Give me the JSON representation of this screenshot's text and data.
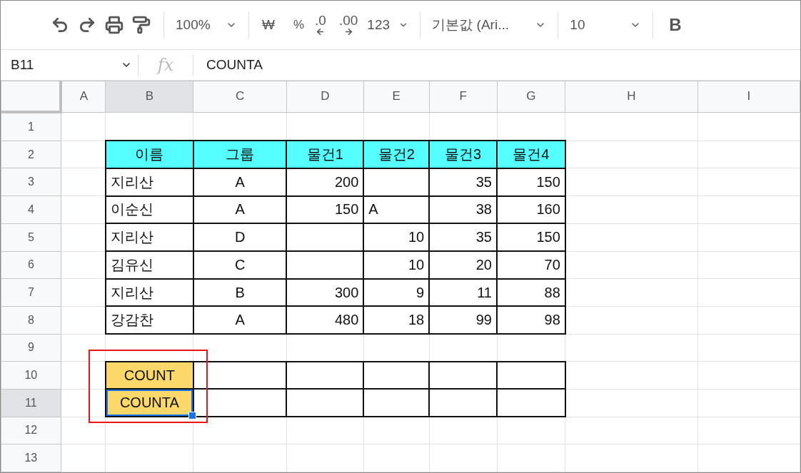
{
  "toolbar": {
    "zoom": "100%",
    "currency": "₩",
    "percent": "%",
    "decrease_decimal": ".0",
    "increase_decimal": ".00",
    "number_format": "123",
    "font": "기본값 (Ari...",
    "font_size": "10",
    "bold": "B"
  },
  "formula_bar": {
    "cell_ref": "B11",
    "fx": "fx",
    "value": "COUNTA"
  },
  "columns": [
    {
      "label": "A",
      "selected": false
    },
    {
      "label": "B",
      "selected": true
    },
    {
      "label": "C",
      "selected": false
    },
    {
      "label": "D",
      "selected": false
    },
    {
      "label": "E",
      "selected": false
    },
    {
      "label": "F",
      "selected": false
    },
    {
      "label": "G",
      "selected": false
    },
    {
      "label": "H",
      "selected": false
    },
    {
      "label": "I",
      "selected": false
    }
  ],
  "rows": [
    {
      "number": "1",
      "selected": false
    },
    {
      "number": "2",
      "selected": false,
      "cells": [
        {
          "kind": "head",
          "value": "이름",
          "selected": false
        },
        {
          "kind": "head",
          "value": "그룹",
          "selected": false
        },
        {
          "kind": "head",
          "value": "물건1",
          "selected": false
        },
        {
          "kind": "head",
          "value": "물건2",
          "selected": false
        },
        {
          "kind": "head",
          "value": "물건3",
          "selected": false
        },
        {
          "kind": "head",
          "value": "물건4",
          "selected": false
        }
      ]
    },
    {
      "number": "3",
      "selected": false,
      "cells": [
        {
          "kind": "left",
          "value": "지리산",
          "selected": false
        },
        {
          "kind": "center",
          "value": "A",
          "selected": false
        },
        {
          "kind": "number",
          "value": "200",
          "selected": false
        },
        {
          "kind": "boxed",
          "selected": false
        },
        {
          "kind": "number",
          "value": "35",
          "selected": false
        },
        {
          "kind": "number",
          "value": "150",
          "selected": false
        }
      ]
    },
    {
      "number": "4",
      "selected": false,
      "cells": [
        {
          "kind": "left",
          "value": "이순신",
          "selected": false
        },
        {
          "kind": "center",
          "value": "A",
          "selected": false
        },
        {
          "kind": "number",
          "value": "150",
          "selected": false
        },
        {
          "kind": "left",
          "value": "A",
          "selected": false
        },
        {
          "kind": "number",
          "value": "38",
          "selected": false
        },
        {
          "kind": "number",
          "value": "160",
          "selected": false
        }
      ]
    },
    {
      "number": "5",
      "selected": false,
      "cells": [
        {
          "kind": "left",
          "value": "지리산",
          "selected": false
        },
        {
          "kind": "center",
          "value": "D",
          "selected": false
        },
        {
          "kind": "boxed",
          "selected": false
        },
        {
          "kind": "number",
          "value": "10",
          "selected": false
        },
        {
          "kind": "number",
          "value": "35",
          "selected": false
        },
        {
          "kind": "number",
          "value": "150",
          "selected": false
        }
      ]
    },
    {
      "number": "6",
      "selected": false,
      "cells": [
        {
          "kind": "left",
          "value": "김유신",
          "selected": false
        },
        {
          "kind": "center",
          "value": "C",
          "selected": false
        },
        {
          "kind": "boxed",
          "selected": false
        },
        {
          "kind": "number",
          "value": "10",
          "selected": false
        },
        {
          "kind": "number",
          "value": "20",
          "selected": false
        },
        {
          "kind": "number",
          "value": "70",
          "selected": false
        }
      ]
    },
    {
      "number": "7",
      "selected": false,
      "cells": [
        {
          "kind": "left",
          "value": "지리산",
          "selected": false
        },
        {
          "kind": "center",
          "value": "B",
          "selected": false
        },
        {
          "kind": "number",
          "value": "300",
          "selected": false
        },
        {
          "kind": "number",
          "value": "9",
          "selected": false
        },
        {
          "kind": "number",
          "value": "11",
          "selected": false
        },
        {
          "kind": "number",
          "value": "88",
          "selected": false
        }
      ]
    },
    {
      "number": "8",
      "selected": false,
      "cells": [
        {
          "kind": "left",
          "value": "강감찬",
          "selected": false
        },
        {
          "kind": "center",
          "value": "A",
          "selected": false
        },
        {
          "kind": "number",
          "value": "480",
          "selected": false
        },
        {
          "kind": "number",
          "value": "18",
          "selected": false
        },
        {
          "kind": "number",
          "value": "99",
          "selected": false
        },
        {
          "kind": "number",
          "value": "98",
          "selected": false
        }
      ]
    },
    {
      "number": "9",
      "selected": false
    },
    {
      "number": "10",
      "selected": false,
      "cells": [
        {
          "kind": "label",
          "value": "COUNT",
          "selected": false,
          "framed": true
        },
        {
          "kind": "boxed",
          "selected": false
        },
        {
          "kind": "boxed",
          "selected": false
        },
        {
          "kind": "boxed",
          "selected": false
        },
        {
          "kind": "boxed",
          "selected": false
        },
        {
          "kind": "boxed",
          "selected": false
        }
      ]
    },
    {
      "number": "11",
      "selected": true,
      "cells": [
        {
          "kind": "label",
          "value": "COUNTA",
          "selected": true
        },
        {
          "kind": "boxed",
          "selected": false
        },
        {
          "kind": "boxed",
          "selected": false
        },
        {
          "kind": "boxed",
          "selected": false
        },
        {
          "kind": "boxed",
          "selected": false
        },
        {
          "kind": "boxed",
          "selected": false
        }
      ]
    },
    {
      "number": "12",
      "selected": false
    },
    {
      "number": "13",
      "selected": false
    }
  ]
}
